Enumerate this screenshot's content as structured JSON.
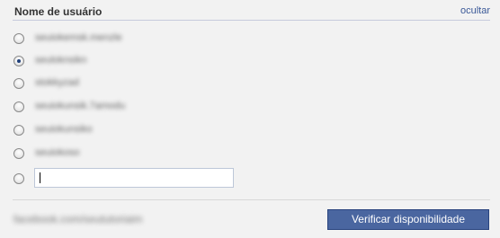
{
  "header": {
    "title": "Nome de usuário",
    "hide_label": "ocultar"
  },
  "options": [
    {
      "text": "seuiokemsk.menzle",
      "checked": false
    },
    {
      "text": "seuloknsikn",
      "checked": true
    },
    {
      "text": "stokkyzad",
      "checked": false
    },
    {
      "text": "seuiokunsik.7amodu",
      "checked": false
    },
    {
      "text": "seuiokunsiko",
      "checked": false
    },
    {
      "text": "seuiokoso",
      "checked": false
    }
  ],
  "custom_input": {
    "value": ""
  },
  "footer": {
    "url": "facebook.com/seututoriaim",
    "check_button": "Verificar disponibilidade"
  }
}
